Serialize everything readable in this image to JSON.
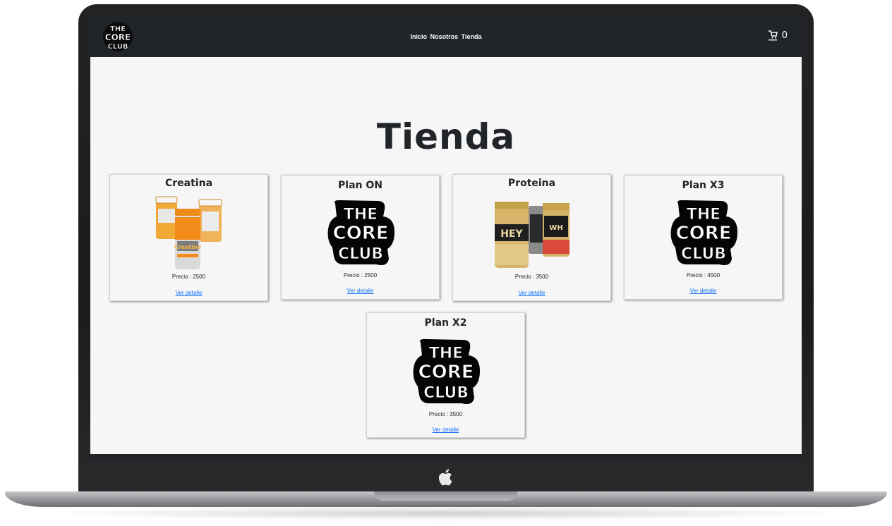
{
  "navbar": {
    "brand": "THE CORE CLUB",
    "links": [
      "Inicio",
      "Nosotros",
      "Tienda"
    ],
    "cart_count": "0"
  },
  "page": {
    "title": "Tienda"
  },
  "products": [
    {
      "name": "Creatina",
      "image": "creatine-jars",
      "price_label": "Precio : 2500",
      "link": "Ver detalle"
    },
    {
      "name": "Plan ON",
      "image": "core-club-logo",
      "price_label": "Precio : 2500",
      "link": "Ver detalle"
    },
    {
      "name": "Proteina",
      "image": "whey-protein-cans",
      "price_label": "Precio : 3500",
      "link": "Ver detalle"
    },
    {
      "name": "Plan X3",
      "image": "core-club-logo",
      "price_label": "Precio : 4500",
      "link": "Ver detalle"
    },
    {
      "name": "Plan X2",
      "image": "core-club-logo",
      "price_label": "Precio : 3500",
      "link": "Ver detalle"
    }
  ],
  "colors": {
    "navbar": "#212529",
    "background": "#f6f6f6",
    "link": "#0d6efd"
  }
}
